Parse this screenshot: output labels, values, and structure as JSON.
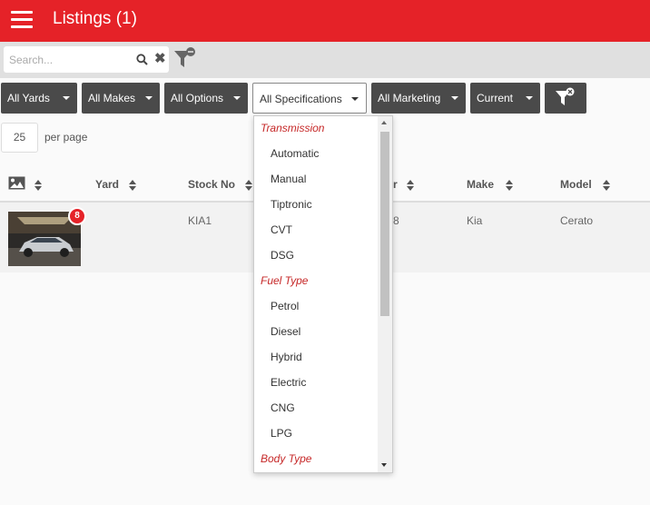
{
  "app": {
    "title": "Listings (1)",
    "accent_color": "#e52228",
    "menu_icon": "hamburger-menu-icon"
  },
  "search": {
    "placeholder": "Search...",
    "value": "",
    "search_icon": "search-icon",
    "clear_icon": "close-icon",
    "clear_filter_icon": "filter-clear-icon"
  },
  "filters": [
    {
      "label": "All Yards"
    },
    {
      "label": "All Makes"
    },
    {
      "label": "All Options"
    },
    {
      "label": "All Specifications",
      "open": true
    },
    {
      "label": "All Marketing"
    },
    {
      "label": "Current"
    }
  ],
  "pagination": {
    "per_page_value": "25",
    "per_page_label": "per page"
  },
  "table": {
    "columns": [
      "",
      "Yard",
      "Stock No",
      "r",
      "Make",
      "Model"
    ],
    "rows": [
      {
        "image_badge": "8",
        "yard": "",
        "stock_no": "KIA1",
        "year_fragment": "8",
        "make": "Kia",
        "model": "Cerato"
      }
    ]
  },
  "dropdown": {
    "groups": [
      {
        "label": "Transmission",
        "items": [
          "Automatic",
          "Manual",
          "Tiptronic",
          "CVT",
          "DSG"
        ]
      },
      {
        "label": "Fuel Type",
        "items": [
          "Petrol",
          "Diesel",
          "Hybrid",
          "Electric",
          "CNG",
          "LPG"
        ]
      },
      {
        "label": "Body Type",
        "items": []
      }
    ]
  }
}
